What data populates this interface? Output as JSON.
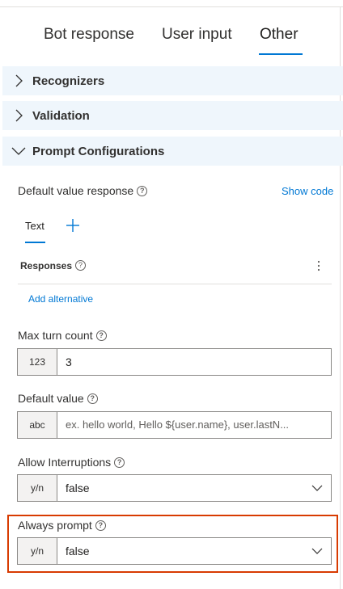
{
  "tabs": [
    {
      "label": "Bot response",
      "active": false
    },
    {
      "label": "User input",
      "active": false
    },
    {
      "label": "Other",
      "active": true
    }
  ],
  "sections": [
    {
      "label": "Recognizers",
      "expanded": false
    },
    {
      "label": "Validation",
      "expanded": false
    },
    {
      "label": "Prompt Configurations",
      "expanded": true
    }
  ],
  "default_value_response": {
    "label": "Default value response",
    "show_code": "Show code",
    "subtab": "Text",
    "responses_label": "Responses",
    "add_alternative": "Add alternative"
  },
  "max_turn_count": {
    "label": "Max turn count",
    "prefix": "123",
    "value": "3"
  },
  "default_value": {
    "label": "Default value",
    "prefix": "abc",
    "placeholder": "ex. hello world, Hello ${user.name}, user.lastN..."
  },
  "allow_interruptions": {
    "label": "Allow Interruptions",
    "prefix": "y/n",
    "value": "false"
  },
  "always_prompt": {
    "label": "Always prompt",
    "prefix": "y/n",
    "value": "false"
  },
  "colors": {
    "accent": "#0078d4",
    "section_bg": "#eff6fc",
    "highlight": "#d83b01"
  },
  "icons": [
    "chevron-right-icon",
    "chevron-down-icon",
    "help-icon",
    "plus-icon",
    "more-vertical-icon"
  ]
}
